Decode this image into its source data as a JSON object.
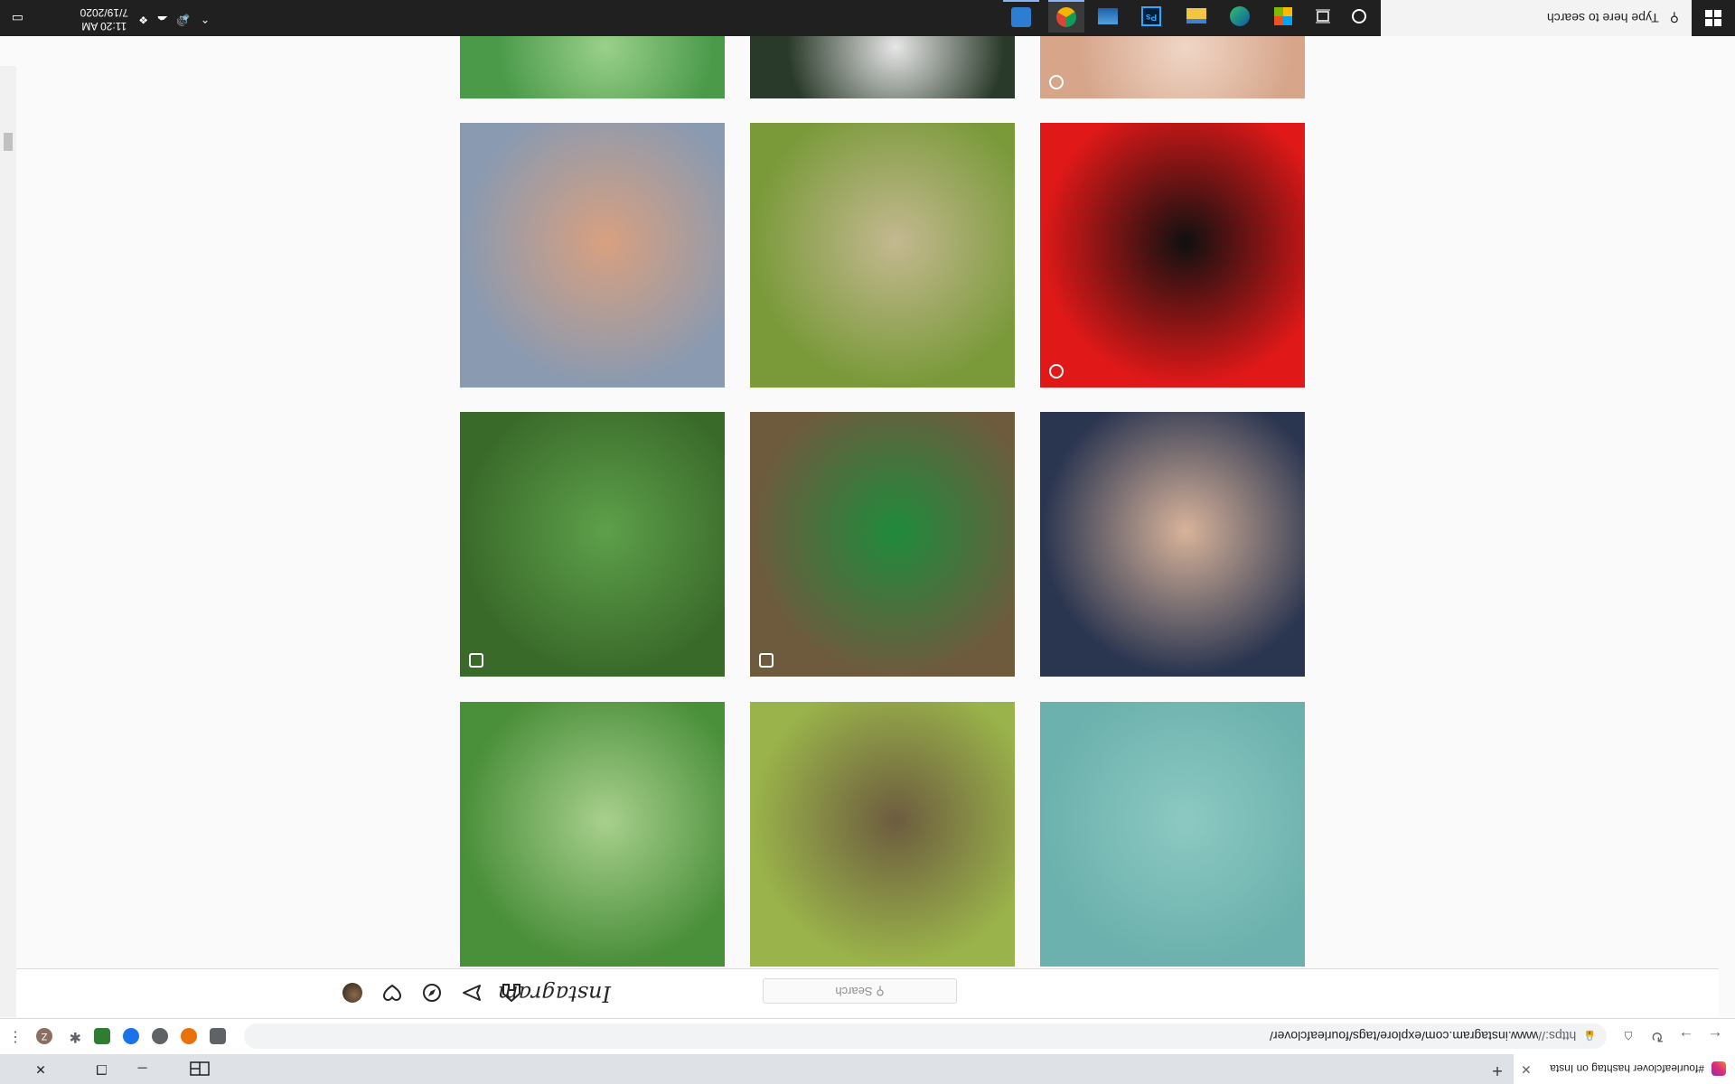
{
  "browser": {
    "tab_title": "#fourleafclover hashtag on Insta",
    "url_scheme": "https://",
    "url_rest": "www.instagram.com/explore/tags/fourleafclover/"
  },
  "instagram": {
    "logo": "Instagram",
    "search_placeholder": "Search",
    "search_icon_glyph": "⚲"
  },
  "posts": [
    {
      "desc": "clover top-left (partial)",
      "colors": [
        "#4a8f3a",
        "#a8d08d"
      ]
    },
    {
      "desc": "puppy on grass (partial)",
      "colors": [
        "#9ab34a",
        "#6d5c3f"
      ]
    },
    {
      "desc": "teal (partial)",
      "colors": [
        "#6cb1ad",
        "#8cc9c2"
      ]
    },
    {
      "desc": "dog with clover",
      "colors": [
        "#3a6a2a",
        "#5da04a"
      ],
      "badge": true
    },
    {
      "desc": "4-H patch",
      "colors": [
        "#6e5b3e",
        "#1f8a3c"
      ],
      "badge": true
    },
    {
      "desc": "girl holding clovers",
      "colors": [
        "#2a3550",
        "#d8b39a"
      ]
    },
    {
      "desc": "child in dinosaur sweater",
      "colors": [
        "#8a9ab0",
        "#d8a080"
      ]
    },
    {
      "desc": "person sitting on grass",
      "colors": [
        "#7a9a3a",
        "#c4b890"
      ]
    },
    {
      "desc": "silhouette on red",
      "colors": [
        "#e01818",
        "#101010"
      ],
      "video": true
    },
    {
      "desc": "clover bouquet",
      "colors": [
        "#4a9a4a",
        "#9ad08a"
      ]
    },
    {
      "desc": "glove holding clover",
      "colors": [
        "#2a3a2a",
        "#e6e6e6"
      ]
    },
    {
      "desc": "bracelets",
      "colors": [
        "#d6a58a",
        "#f0d6c6"
      ],
      "video": true
    }
  ],
  "taskbar": {
    "search_placeholder": "Type here to search",
    "time": "11:20 AM",
    "date": "7/19/2020"
  },
  "icons": {
    "start": "windows-start-icon",
    "cortana": "circle-icon",
    "taskview": "task-view-icon"
  }
}
